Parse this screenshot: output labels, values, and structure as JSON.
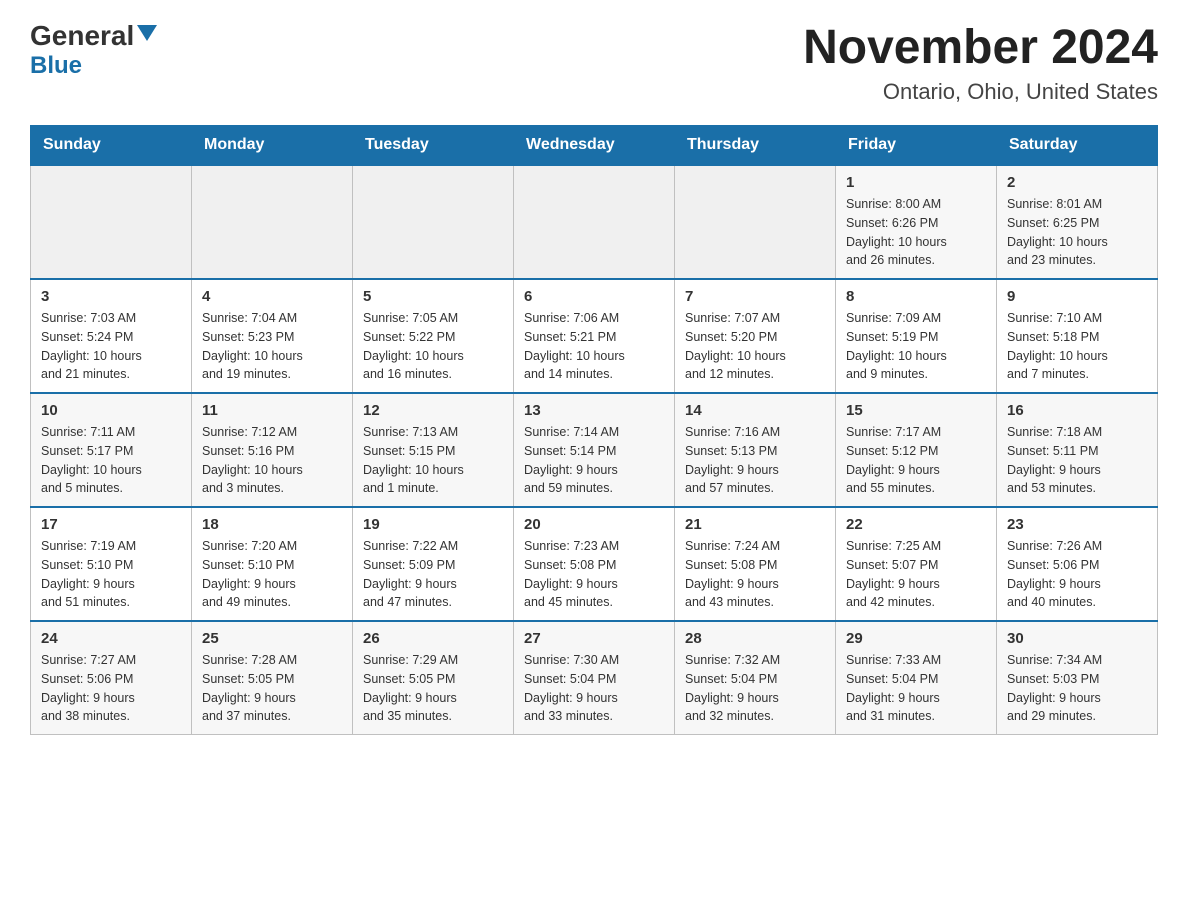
{
  "logo": {
    "general": "General",
    "blue": "Blue"
  },
  "title": "November 2024",
  "subtitle": "Ontario, Ohio, United States",
  "days_header": [
    "Sunday",
    "Monday",
    "Tuesday",
    "Wednesday",
    "Thursday",
    "Friday",
    "Saturday"
  ],
  "weeks": [
    {
      "cells": [
        {
          "day": "",
          "info": ""
        },
        {
          "day": "",
          "info": ""
        },
        {
          "day": "",
          "info": ""
        },
        {
          "day": "",
          "info": ""
        },
        {
          "day": "",
          "info": ""
        },
        {
          "day": "1",
          "info": "Sunrise: 8:00 AM\nSunset: 6:26 PM\nDaylight: 10 hours\nand 26 minutes."
        },
        {
          "day": "2",
          "info": "Sunrise: 8:01 AM\nSunset: 6:25 PM\nDaylight: 10 hours\nand 23 minutes."
        }
      ]
    },
    {
      "cells": [
        {
          "day": "3",
          "info": "Sunrise: 7:03 AM\nSunset: 5:24 PM\nDaylight: 10 hours\nand 21 minutes."
        },
        {
          "day": "4",
          "info": "Sunrise: 7:04 AM\nSunset: 5:23 PM\nDaylight: 10 hours\nand 19 minutes."
        },
        {
          "day": "5",
          "info": "Sunrise: 7:05 AM\nSunset: 5:22 PM\nDaylight: 10 hours\nand 16 minutes."
        },
        {
          "day": "6",
          "info": "Sunrise: 7:06 AM\nSunset: 5:21 PM\nDaylight: 10 hours\nand 14 minutes."
        },
        {
          "day": "7",
          "info": "Sunrise: 7:07 AM\nSunset: 5:20 PM\nDaylight: 10 hours\nand 12 minutes."
        },
        {
          "day": "8",
          "info": "Sunrise: 7:09 AM\nSunset: 5:19 PM\nDaylight: 10 hours\nand 9 minutes."
        },
        {
          "day": "9",
          "info": "Sunrise: 7:10 AM\nSunset: 5:18 PM\nDaylight: 10 hours\nand 7 minutes."
        }
      ]
    },
    {
      "cells": [
        {
          "day": "10",
          "info": "Sunrise: 7:11 AM\nSunset: 5:17 PM\nDaylight: 10 hours\nand 5 minutes."
        },
        {
          "day": "11",
          "info": "Sunrise: 7:12 AM\nSunset: 5:16 PM\nDaylight: 10 hours\nand 3 minutes."
        },
        {
          "day": "12",
          "info": "Sunrise: 7:13 AM\nSunset: 5:15 PM\nDaylight: 10 hours\nand 1 minute."
        },
        {
          "day": "13",
          "info": "Sunrise: 7:14 AM\nSunset: 5:14 PM\nDaylight: 9 hours\nand 59 minutes."
        },
        {
          "day": "14",
          "info": "Sunrise: 7:16 AM\nSunset: 5:13 PM\nDaylight: 9 hours\nand 57 minutes."
        },
        {
          "day": "15",
          "info": "Sunrise: 7:17 AM\nSunset: 5:12 PM\nDaylight: 9 hours\nand 55 minutes."
        },
        {
          "day": "16",
          "info": "Sunrise: 7:18 AM\nSunset: 5:11 PM\nDaylight: 9 hours\nand 53 minutes."
        }
      ]
    },
    {
      "cells": [
        {
          "day": "17",
          "info": "Sunrise: 7:19 AM\nSunset: 5:10 PM\nDaylight: 9 hours\nand 51 minutes."
        },
        {
          "day": "18",
          "info": "Sunrise: 7:20 AM\nSunset: 5:10 PM\nDaylight: 9 hours\nand 49 minutes."
        },
        {
          "day": "19",
          "info": "Sunrise: 7:22 AM\nSunset: 5:09 PM\nDaylight: 9 hours\nand 47 minutes."
        },
        {
          "day": "20",
          "info": "Sunrise: 7:23 AM\nSunset: 5:08 PM\nDaylight: 9 hours\nand 45 minutes."
        },
        {
          "day": "21",
          "info": "Sunrise: 7:24 AM\nSunset: 5:08 PM\nDaylight: 9 hours\nand 43 minutes."
        },
        {
          "day": "22",
          "info": "Sunrise: 7:25 AM\nSunset: 5:07 PM\nDaylight: 9 hours\nand 42 minutes."
        },
        {
          "day": "23",
          "info": "Sunrise: 7:26 AM\nSunset: 5:06 PM\nDaylight: 9 hours\nand 40 minutes."
        }
      ]
    },
    {
      "cells": [
        {
          "day": "24",
          "info": "Sunrise: 7:27 AM\nSunset: 5:06 PM\nDaylight: 9 hours\nand 38 minutes."
        },
        {
          "day": "25",
          "info": "Sunrise: 7:28 AM\nSunset: 5:05 PM\nDaylight: 9 hours\nand 37 minutes."
        },
        {
          "day": "26",
          "info": "Sunrise: 7:29 AM\nSunset: 5:05 PM\nDaylight: 9 hours\nand 35 minutes."
        },
        {
          "day": "27",
          "info": "Sunrise: 7:30 AM\nSunset: 5:04 PM\nDaylight: 9 hours\nand 33 minutes."
        },
        {
          "day": "28",
          "info": "Sunrise: 7:32 AM\nSunset: 5:04 PM\nDaylight: 9 hours\nand 32 minutes."
        },
        {
          "day": "29",
          "info": "Sunrise: 7:33 AM\nSunset: 5:04 PM\nDaylight: 9 hours\nand 31 minutes."
        },
        {
          "day": "30",
          "info": "Sunrise: 7:34 AM\nSunset: 5:03 PM\nDaylight: 9 hours\nand 29 minutes."
        }
      ]
    }
  ]
}
